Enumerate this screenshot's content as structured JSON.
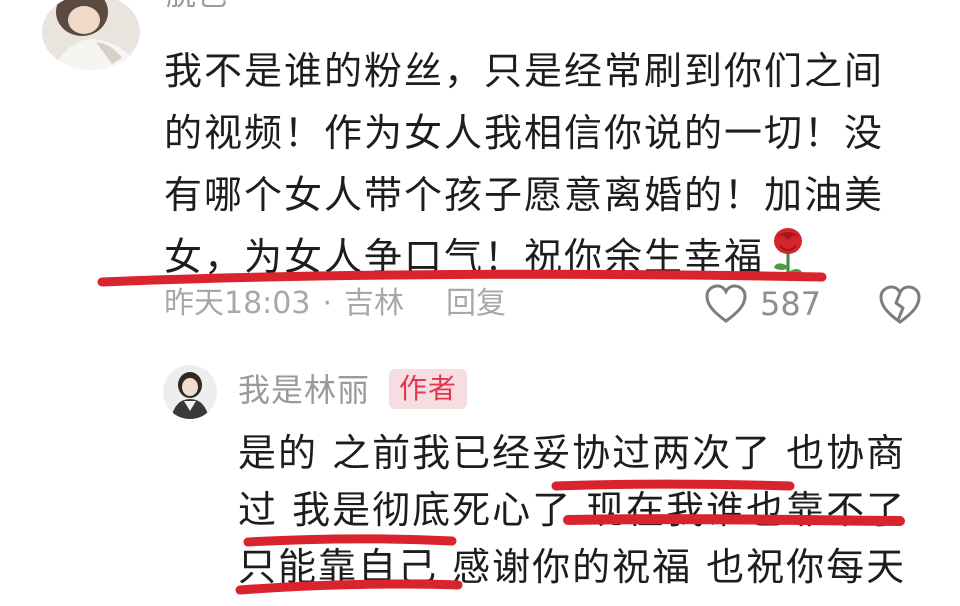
{
  "comment": {
    "username": "脱色",
    "lines": [
      "我不是谁的粉丝，只是经常刷到你们之间",
      "的视频！作为女人我相信你说的一切！没",
      "有哪个女人带个孩子愿意离婚的！加油美",
      "女，为女人争口气！祝你余生幸福"
    ],
    "emoji": "rose-icon",
    "time": "昨天18:03",
    "separator": "·",
    "location": "吉林",
    "reply_label": "回复",
    "like_count": "587"
  },
  "reply": {
    "username": "我是林丽",
    "badge": "作者",
    "lines": [
      "是的 之前我已经妥协过两次了 也协商",
      "过 我是彻底死心了 现在我谁也靠不了",
      "只能靠自己 感谢你的祝福 也祝你每天"
    ]
  },
  "colors": {
    "badge_bg": "#f6dde1",
    "badge_text": "#e3374f",
    "marker": "#d9232d",
    "meta_text": "#a8a8a8"
  },
  "icons": {
    "like": "heart-icon",
    "dislike": "broken-heart-icon"
  }
}
